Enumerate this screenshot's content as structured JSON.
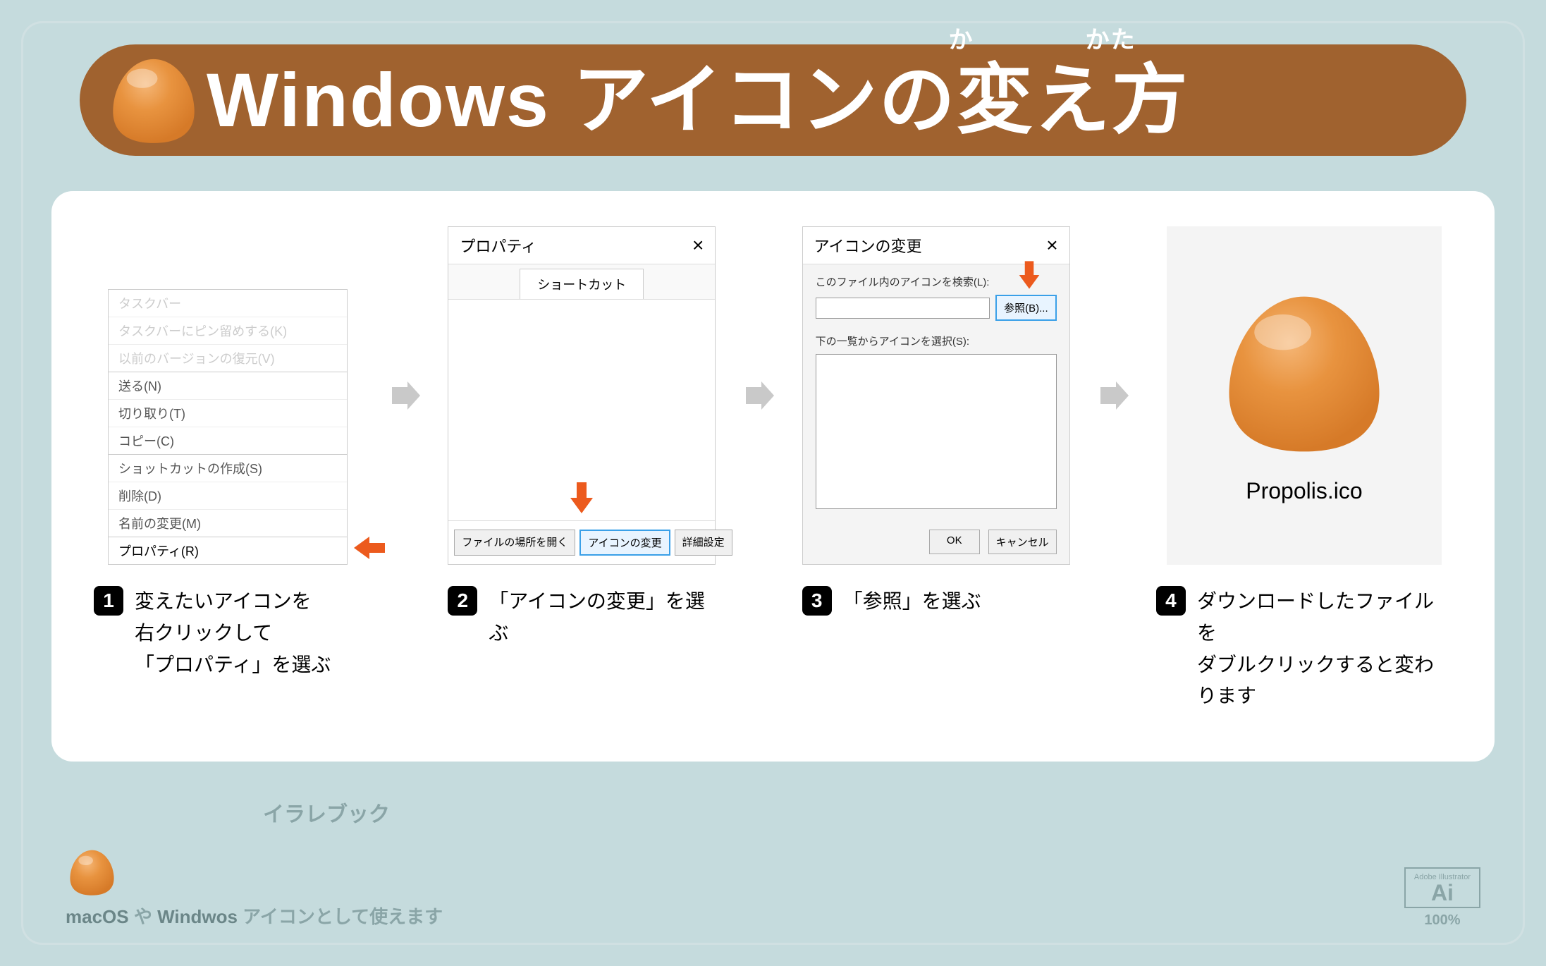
{
  "title": {
    "main": "Windows アイコンの変え方",
    "ruby1": "か",
    "ruby2": "かた"
  },
  "steps": [
    {
      "num": "1",
      "caption": "変えたいアイコンを\n右クリックして\n「プロパティ」を選ぶ",
      "context_menu": {
        "faded": [
          "タスクバー",
          "タスクバーにピン留めする(K)",
          "以前のバージョンの復元(V)"
        ],
        "items": [
          "送る(N)",
          "切り取り(T)",
          "コピー(C)"
        ],
        "items2": [
          "ショットカットの作成(S)",
          "削除(D)",
          "名前の変更(M)"
        ],
        "highlight": "プロパティ(R)"
      }
    },
    {
      "num": "2",
      "caption": "「アイコンの変更」を選ぶ",
      "window": {
        "title": "プロパティ",
        "tab": "ショートカット",
        "buttons": [
          "ファイルの場所を開く",
          "アイコンの変更",
          "詳細設定"
        ]
      }
    },
    {
      "num": "3",
      "caption": "「参照」を選ぶ",
      "window": {
        "title": "アイコンの変更",
        "label1": "このファイル内のアイコンを検索(L):",
        "browse": "参照(B)...",
        "label2": "下の一覧からアイコンを選択(S):",
        "ok": "OK",
        "cancel": "キャンセル"
      }
    },
    {
      "num": "4",
      "caption": "ダウンロードしたファイルを\nダブルクリックすると変わります",
      "filename": "Propolis.ico"
    }
  ],
  "footer": {
    "brand": "イラレブック",
    "text_prefix": "macOS",
    "text_mid": " や ",
    "text_bold": "Windwos",
    "text_suffix": " アイコンとして使えます",
    "badge_small": "Adobe Illustrator",
    "badge_big": "Ai",
    "zoom": "100%"
  }
}
